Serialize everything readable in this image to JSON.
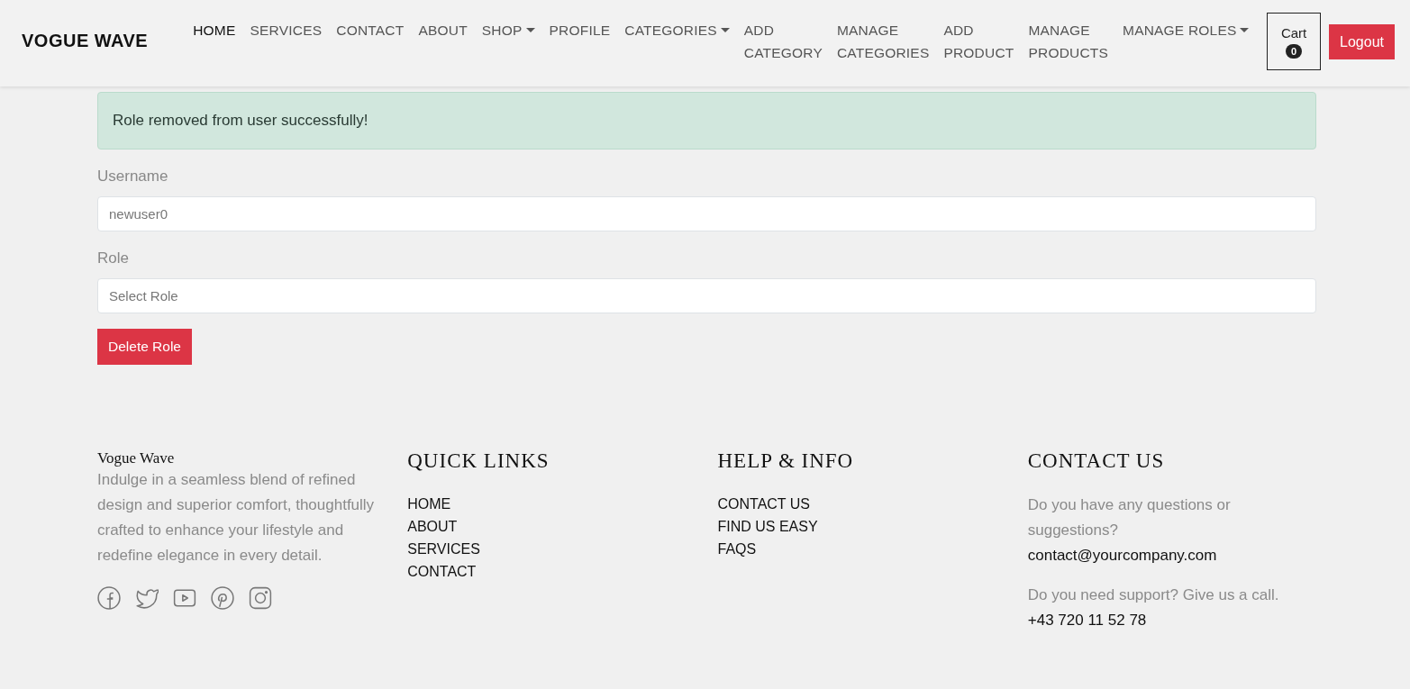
{
  "header": {
    "logo": "VOGUE WAVE",
    "nav": [
      {
        "label": "HOME",
        "selected": true,
        "dropdown": false
      },
      {
        "label": "SERVICES",
        "selected": false,
        "dropdown": false
      },
      {
        "label": "CONTACT",
        "selected": false,
        "dropdown": false
      },
      {
        "label": "ABOUT",
        "selected": false,
        "dropdown": false
      },
      {
        "label": "SHOP",
        "selected": false,
        "dropdown": true
      },
      {
        "label": "PROFILE",
        "selected": false,
        "dropdown": false
      },
      {
        "label": "CATEGORIES",
        "selected": false,
        "dropdown": true
      },
      {
        "label": "ADD CATEGORY",
        "selected": false,
        "dropdown": false
      },
      {
        "label": "MANAGE CATEGORIES",
        "selected": false,
        "dropdown": false
      },
      {
        "label": "ADD PRODUCT",
        "selected": false,
        "dropdown": false
      },
      {
        "label": "MANAGE PRODUCTS",
        "selected": false,
        "dropdown": false
      },
      {
        "label": "MANAGE ROLES",
        "selected": false,
        "dropdown": true
      }
    ],
    "cart": {
      "label": "Cart",
      "count": "0"
    },
    "logout": "Logout"
  },
  "alert": "Role removed from user successfully!",
  "form": {
    "fields": [
      {
        "label": "Username",
        "value": "newuser0"
      },
      {
        "label": "Role",
        "placeholder": "Select Role"
      }
    ],
    "submit": "Delete Role"
  },
  "footer": {
    "brand": "Vogue Wave",
    "about": "Indulge in a seamless blend of refined design and superior comfort, thoughtfully crafted to enhance your lifestyle and redefine elegance in every detail.",
    "quick_links": {
      "title": "QUICK LINKS",
      "links": [
        "HOME",
        "ABOUT",
        "SERVICES",
        "CONTACT"
      ]
    },
    "help": {
      "title": "HELP & INFO",
      "links": [
        "CONTACT US",
        "FIND US EASY",
        "FAQS"
      ]
    },
    "contact": {
      "title": "CONTACT US",
      "question": "Do you have any questions or suggestions?",
      "email": "contact@yourcompany.com",
      "support": "Do you need support? Give us a call.",
      "phone": "+43 720 11 52 78"
    }
  }
}
